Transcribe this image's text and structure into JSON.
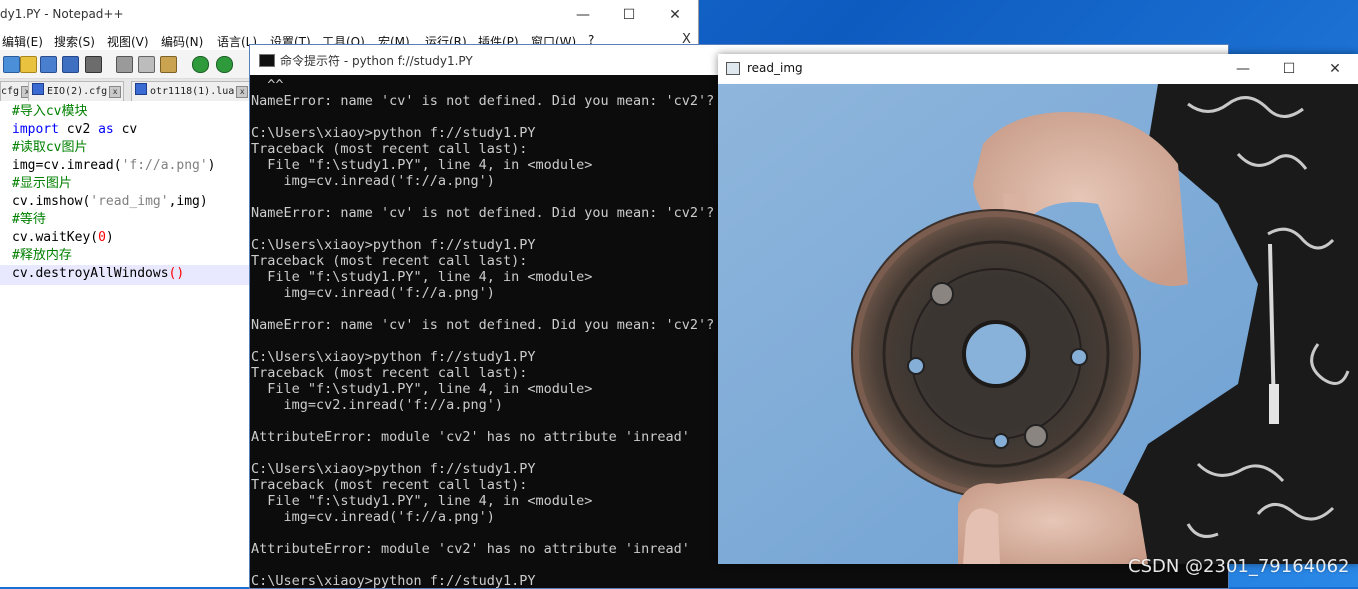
{
  "npp": {
    "title": "dy1.PY - Notepad++",
    "menu": [
      "编辑(E)",
      "搜索(S)",
      "视图(V)",
      "编码(N)",
      "语言(L)",
      "设置(T)",
      "工具(O)",
      "宏(M)",
      "运行(R)",
      "插件(P)",
      "窗口(W)",
      "?"
    ],
    "tabs": [
      "cfg",
      "EIO(2).cfg",
      "otr1118(1).lua"
    ],
    "close_x": "X",
    "code": [
      "#导入cv模块",
      "import cv2 as cv",
      "#读取cv图片",
      "img=cv.imread('f://a.png')",
      "#显示图片",
      "cv.imshow('read_img',img)",
      "#等待",
      "cv.waitKey(0)",
      "#释放内存",
      "cv.destroyAllWindows()"
    ]
  },
  "cmd": {
    "title": "命令提示符 - python  f://study1.PY",
    "lines": [
      "  ^^",
      "NameError: name 'cv' is not defined. Did you mean: 'cv2'?",
      "",
      "C:\\Users\\xiaoy>python f://study1.PY",
      "Traceback (most recent call last):",
      "  File \"f:\\study1.PY\", line 4, in <module>",
      "    img=cv.inread('f://a.png')",
      "",
      "NameError: name 'cv' is not defined. Did you mean: 'cv2'?",
      "",
      "C:\\Users\\xiaoy>python f://study1.PY",
      "Traceback (most recent call last):",
      "  File \"f:\\study1.PY\", line 4, in <module>",
      "    img=cv.inread('f://a.png')",
      "",
      "NameError: name 'cv' is not defined. Did you mean: 'cv2'?",
      "",
      "C:\\Users\\xiaoy>python f://study1.PY",
      "Traceback (most recent call last):",
      "  File \"f:\\study1.PY\", line 4, in <module>",
      "    img=cv2.inread('f://a.png')",
      "",
      "AttributeError: module 'cv2' has no attribute 'inread'",
      "",
      "C:\\Users\\xiaoy>python f://study1.PY",
      "Traceback (most recent call last):",
      "  File \"f:\\study1.PY\", line 4, in <module>",
      "    img=cv.inread('f://a.png')",
      "",
      "AttributeError: module 'cv2' has no attribute 'inread'",
      "",
      "C:\\Users\\xiaoy>python f://study1.PY"
    ]
  },
  "image_window": {
    "title": "read_img"
  },
  "captions": {
    "minimize": "—",
    "maximize": "☐",
    "close": "✕"
  },
  "watermark": "CSDN @2301_79164062"
}
